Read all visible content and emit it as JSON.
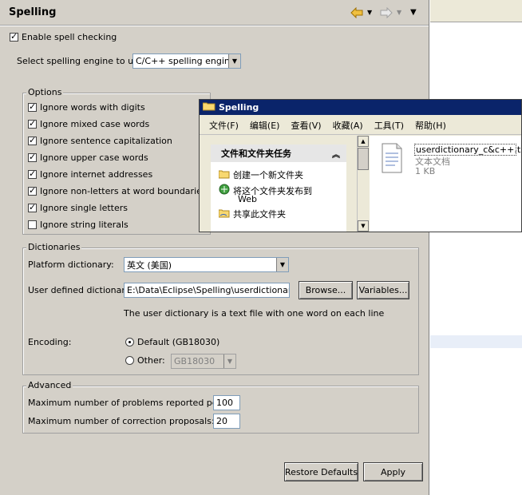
{
  "page": {
    "title": "Spelling",
    "nav": {
      "back_icon": "back-arrow-icon",
      "forward_icon": "forward-arrow-icon",
      "menu_icon": "view-menu-icon"
    }
  },
  "enable": {
    "label": "Enable spell checking",
    "checked": true
  },
  "engine": {
    "label": "Select spelling engine to use:",
    "value": "C/C++ spelling engine"
  },
  "options": {
    "label": "Options",
    "items": [
      {
        "label": "Ignore words with digits",
        "checked": true
      },
      {
        "label": "Ignore mixed case words",
        "checked": true
      },
      {
        "label": "Ignore sentence capitalization",
        "checked": true
      },
      {
        "label": "Ignore upper case words",
        "checked": true
      },
      {
        "label": "Ignore internet addresses",
        "checked": true
      },
      {
        "label": "Ignore non-letters at word boundaries",
        "checked": true
      },
      {
        "label": "Ignore single letters",
        "checked": true
      },
      {
        "label": "Ignore string literals",
        "checked": false
      }
    ]
  },
  "dictionaries": {
    "label": "Dictionaries",
    "platform_label": "Platform dictionary:",
    "platform_value": "英文 (美国)",
    "user_label": "User defined dictionary:",
    "user_value": "E:\\Data\\Eclipse\\Spelling\\userdictionary_c&",
    "browse": "Browse...",
    "variables": "Variables...",
    "hint": "The user dictionary is a text file with one word on each line",
    "encoding_label": "Encoding:",
    "default_label": "Default (GB18030)",
    "other_label": "Other:",
    "other_value": "GB18030"
  },
  "advanced": {
    "label": "Advanced",
    "max_problems_label": "Maximum number of problems reported per file:",
    "max_problems_value": "100",
    "max_proposals_label": "Maximum number of correction proposals:",
    "max_proposals_value": "20"
  },
  "buttons": {
    "restore": "Restore Defaults",
    "apply": "Apply"
  },
  "explorer": {
    "title": "Spelling",
    "menus": [
      "文件(F)",
      "编辑(E)",
      "查看(V)",
      "收藏(A)",
      "工具(T)",
      "帮助(H)"
    ],
    "task_title": "文件和文件夹任务",
    "tasks": [
      "创建一个新文件夹",
      "将这个文件夹发布到",
      "Web",
      "共享此文件夹"
    ],
    "file": {
      "name": "userdictionary_c&c++.txt",
      "type": "文本文档",
      "size": "1 KB"
    }
  }
}
